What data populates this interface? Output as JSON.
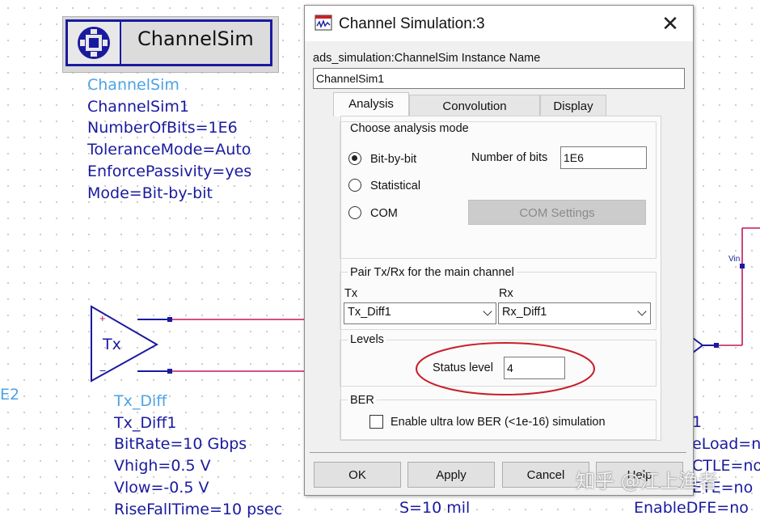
{
  "schematic": {
    "channelsim_block_title": "ChannelSim",
    "channelsim_params": [
      "ChannelSim",
      "ChannelSim1",
      "NumberOfBits=1E6",
      "ToleranceMode=Auto",
      "EnforcePassivity=yes",
      "Mode=Bit-by-bit"
    ],
    "tx_label": "Tx",
    "tx_plus": "+",
    "tx_minus": "−",
    "tx_params": [
      "Tx_Diff",
      "Tx_Diff1",
      "BitRate=10 Gbps",
      "Vhigh=0.5 V",
      "Vlow=-0.5 V",
      "RiseFallTime=10 psec"
    ],
    "left_fragment": "E2",
    "bottom_middle_fragment": "S=10 mil",
    "right_fragments": [
      "1",
      "eLoad=no",
      "CTLE=no",
      "ETE=no",
      "EnableDFE=no"
    ],
    "rx_pin_label": "Vin"
  },
  "dialog": {
    "title": "Channel Simulation:3",
    "instance_name_label": "ads_simulation:ChannelSim Instance Name",
    "instance_name_value": "ChannelSim1",
    "tabs": [
      "Analysis",
      "Convolution",
      "Display"
    ],
    "active_tab": "Analysis",
    "analysis_mode_group": "Choose analysis mode",
    "modes": [
      "Bit-by-bit",
      "Statistical",
      "COM"
    ],
    "selected_mode": "Bit-by-bit",
    "number_of_bits_label": "Number of bits",
    "number_of_bits_value": "1E6",
    "com_settings_button": "COM Settings",
    "pair_group": "Pair Tx/Rx for the main channel",
    "tx_label": "Tx",
    "tx_value": "Tx_Diff1",
    "rx_label": "Rx",
    "rx_value": "Rx_Diff1",
    "levels_group": "Levels",
    "status_level_label": "Status level",
    "status_level_value": "4",
    "ber_group": "BER",
    "ber_checkbox_label": "Enable ultra low BER (<1e-16) simulation",
    "ber_checked": false,
    "buttons": [
      "OK",
      "Apply",
      "Cancel",
      "Help"
    ]
  },
  "watermark": "知乎 @江上渔者",
  "colors": {
    "schematic_blue": "#1a1aa0",
    "schematic_light_blue": "#4da3e6",
    "wire_magenta": "#c2185b",
    "annotation_red": "#c8202a"
  }
}
